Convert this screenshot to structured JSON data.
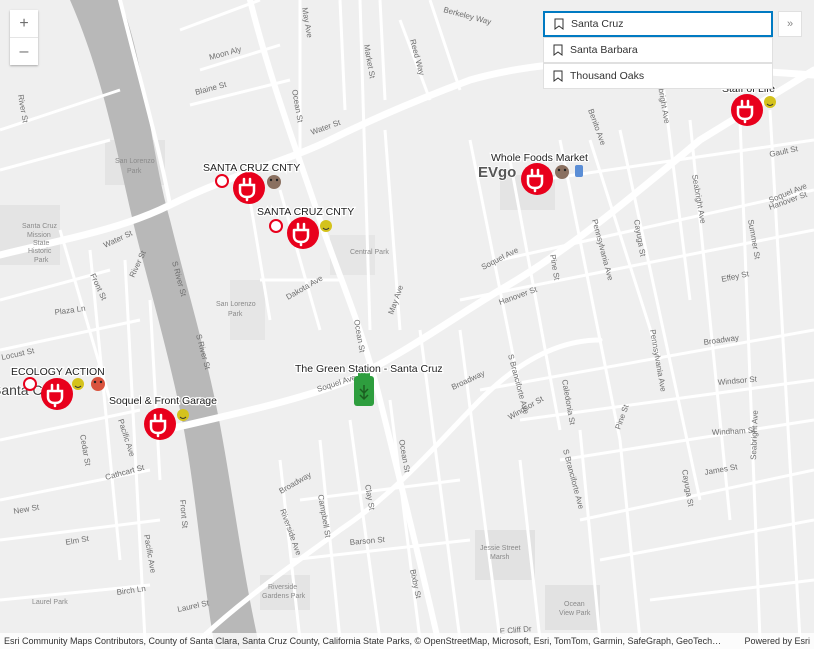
{
  "zoom": {
    "in_label": "+",
    "out_label": "–"
  },
  "search": {
    "input_value": "Santa Cruz",
    "results": [
      "Santa Barbara",
      "Thousand Oaks"
    ],
    "collapse_label": "»"
  },
  "stations": [
    {
      "name": "SANTA CRUZ CNTY"
    },
    {
      "name": "SANTA CRUZ CNTY"
    },
    {
      "name": "Whole Foods Market"
    },
    {
      "name": "Staff of Life"
    },
    {
      "name": "ECOLOGY ACTION"
    },
    {
      "name": "Soquel & Front Garage"
    },
    {
      "name": "The Green Station - Santa Cruz"
    }
  ],
  "places": {
    "city": "Santa Cruz",
    "evgo": "EVgo",
    "san_lorenzo_park_a": "San Lorenzo",
    "san_lorenzo_park_b": "Park",
    "mission_a": "Santa Cruz",
    "mission_b": "Mission",
    "mission_c": "State",
    "mission_d": "Historic",
    "mission_e": "Park",
    "central_park": "Central Park",
    "sl_park2_a": "San Lorenzo",
    "sl_park2_b": "Park",
    "jessie_a": "Jessie Street",
    "jessie_b": "Marsh",
    "riverside_a": "Riverside",
    "riverside_b": "Gardens Park",
    "ocean_view_a": "Ocean",
    "ocean_view_b": "View Park",
    "laurel_park": "Laurel Park"
  },
  "streets": {
    "water_st": "Water St",
    "water_st2": "Water St",
    "soquel_ave": "Soquel Ave",
    "soquel_ave2": "Soquel Ave",
    "soquel_ave3": "Soquel Ave",
    "ocean_st": "Ocean St",
    "ocean_st2": "Ocean St",
    "ocean_st3": "Ocean St",
    "broadway": "Broadway",
    "broadway2": "Broadway",
    "broadway3": "Broadway",
    "river_st": "River St",
    "front_st": "Front St",
    "front_st2": "Front St",
    "pacific_ave": "Pacific Ave",
    "pacific_ave2": "Pacific Ave",
    "cedar_st": "Cedar St",
    "laurel_st": "Laurel St",
    "market_st": "Market St",
    "may_ave": "May Ave",
    "may_ave2": "May Ave",
    "dakota_ave": "Dakota Ave",
    "seabright_ave": "Seabright Ave",
    "seabright_ave2": "Seabright Ave",
    "seabright_ave3": "Seabright Ave",
    "hanover_st": "Hanover St",
    "hanover_st2": "Hanover St",
    "windsor_st": "Windsor St",
    "windsor_st2": "Windsor St",
    "windham_st": "Windham St",
    "james_st": "James St",
    "effey_st": "Effey St",
    "gault_st": "Gault St",
    "summer_st": "Summer St",
    "cayuga_st": "Cayuga St",
    "cayuga_st2": "Cayuga St",
    "pine_st": "Pine St",
    "pine_st2": "Pine St",
    "caledonia_st": "Caledonia St",
    "s_branciforte": "S Branciforte Ave",
    "s_branciforte2": "S Branciforte Ave",
    "pennsylvania_ave": "Pennsylvania Ave",
    "pennsylvania_ave2": "Pennsylvania Ave",
    "benito_ave": "Benito Ave",
    "clay_st": "Clay St",
    "campbell_st": "Campbell St",
    "barson_st": "Barson St",
    "bixby_st": "Bixby St",
    "riverside_ave": "Riverside Ave",
    "cathcart_st": "Cathcart St",
    "elm_st": "Elm St",
    "new_st": "New St",
    "birch_ln": "Birch Ln",
    "locust_st": "Locust St",
    "plaza_ln": "Plaza Ln",
    "blaine_st": "Blaine St",
    "moon_aly": "Moon Aly",
    "berkeley_way": "Berkeley Way",
    "reed_way": "Reed Way",
    "s_river_st": "S River St",
    "s_river_st2": "S River St",
    "e_cliff_dr": "E Cliff Dr",
    "broadway_e": "Broadway"
  },
  "attribution": {
    "text": "Esri Community Maps Contributors, County of Santa Clara, Santa Cruz County, California State Parks, © OpenStreetMap, Microsoft, Esri, TomTom, Garmin, SafeGraph, GeoTech…",
    "powered": "Powered by Esri"
  },
  "colors": {
    "background": "#f0f0f0",
    "road": "#ffffff",
    "river": "#b5b5b5",
    "park": "#e3e3e3",
    "marker_red": "#e8001c",
    "marker_green": "#2e9e3e",
    "accent": "#007ac2"
  },
  "icons": [
    "plus-icon",
    "minus-icon",
    "bookmark-icon",
    "chevron-double-right-icon",
    "ev-plug-icon",
    "fuel-pump-icon",
    "smiley-icon"
  ]
}
